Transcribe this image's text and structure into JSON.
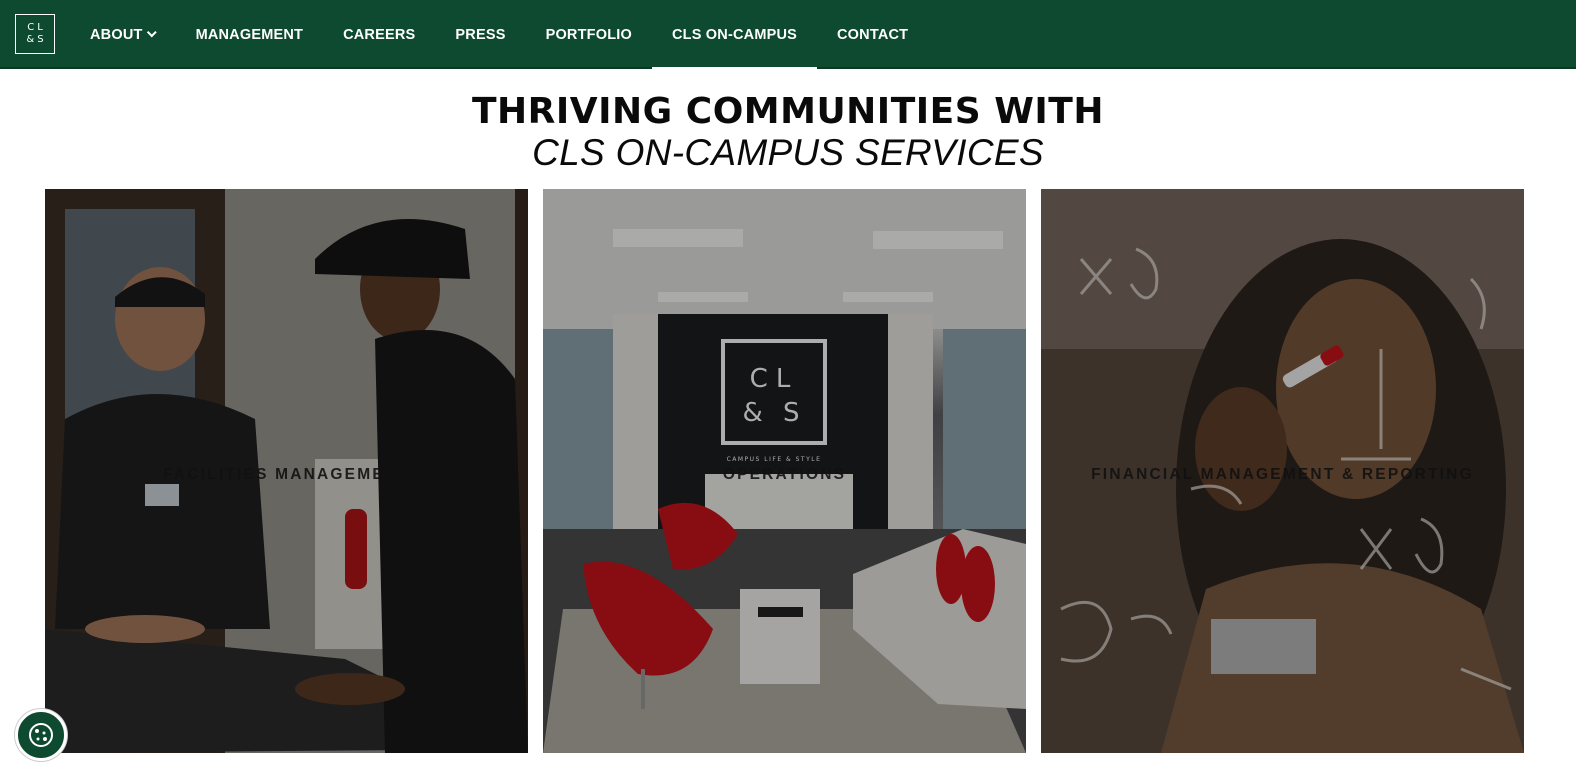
{
  "nav": {
    "logo_line1": "CL",
    "logo_line2": "&S",
    "items": [
      {
        "label": "ABOUT"
      },
      {
        "label": "MANAGEMENT"
      },
      {
        "label": "CAREERS"
      },
      {
        "label": "PRESS"
      },
      {
        "label": "PORTFOLIO"
      },
      {
        "label": "CLS ON-CAMPUS"
      },
      {
        "label": "CONTACT"
      }
    ],
    "active_item": "CLS ON-CAMPUS"
  },
  "hero": {
    "line1": "THRIVING COMMUNITIES WITH",
    "line2": "CLS ON-CAMPUS SERVICES"
  },
  "cards": [
    {
      "label": "FACILITIES MANAGEMENT"
    },
    {
      "label": "OPERATIONS",
      "sign_line1": "CL",
      "sign_line2": "& S",
      "sign_caption": "CAMPUS LIFE & STYLE"
    },
    {
      "label": "FINANCIAL MANAGEMENT & REPORTING"
    }
  ],
  "colors": {
    "nav_bg": "#0e4a30",
    "accent_red": "#c8141b"
  },
  "icons": {
    "cookie": "cookie-icon",
    "caret": "chevron-down-icon"
  }
}
